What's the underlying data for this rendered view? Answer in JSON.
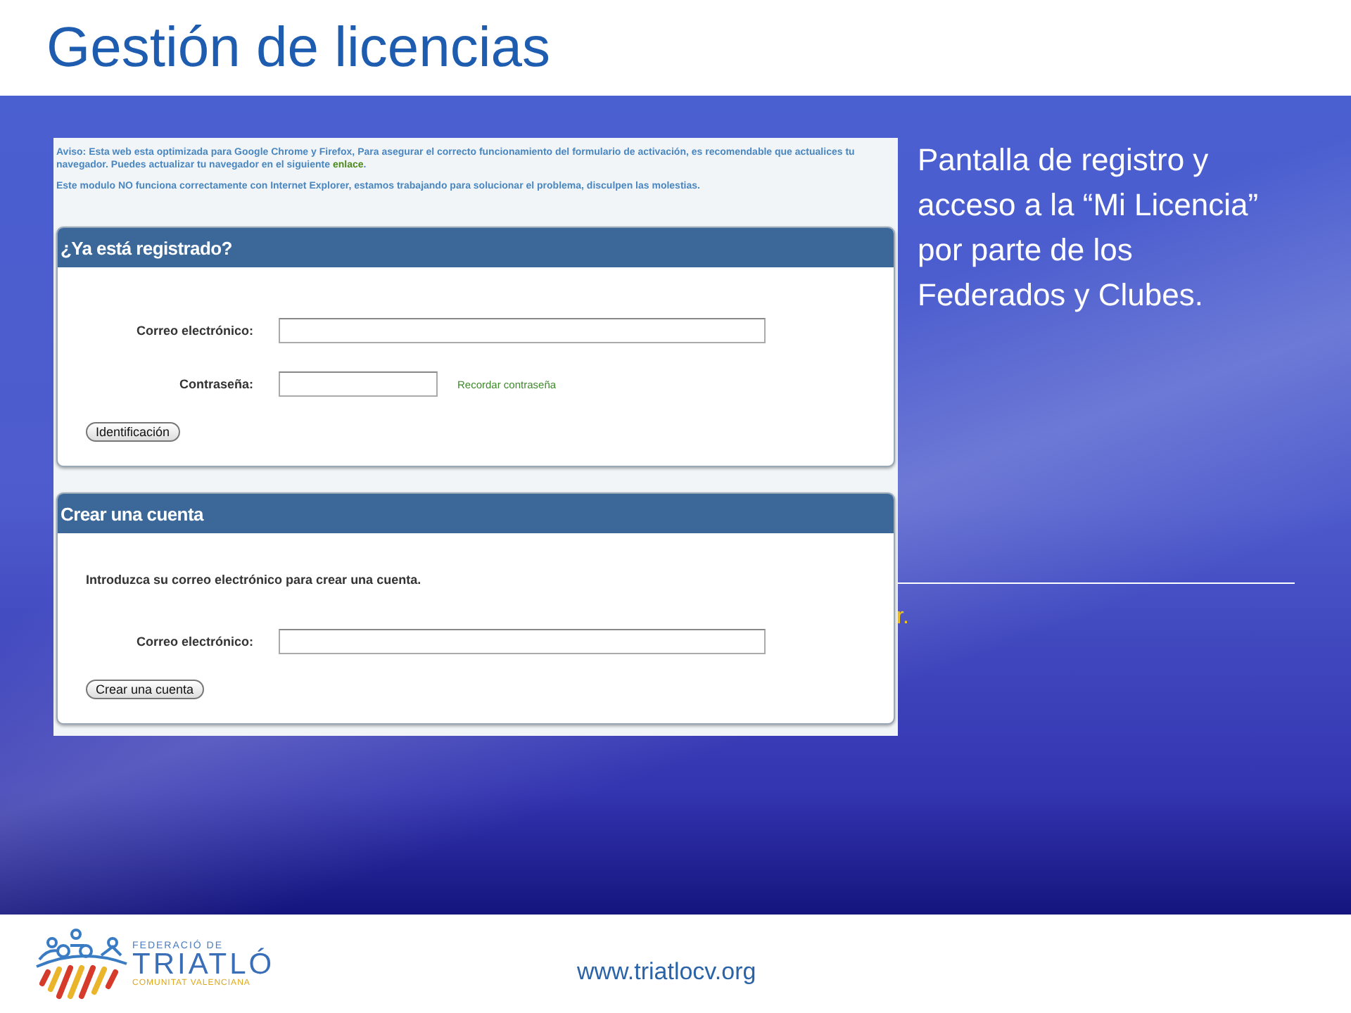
{
  "slide": {
    "title": "Gestión de licencias",
    "description": "Pantalla de registro y acceso a la “Mi Licencia” por parte de los Federados y Clubes.",
    "covered_text": "r."
  },
  "screenshot": {
    "notice": {
      "text": "Aviso: Esta web esta optimizada para Google Chrome y Firefox, Para asegurar el correcto funcionamiento del formulario de activación, es recomendable que actualices tu navegador. Puedes actualizar tu navegador en el siguiente ",
      "link": "enlace",
      "end": "."
    },
    "warning": "Este modulo NO funciona correctamente con Internet Explorer, estamos trabajando para solucionar el problema, disculpen las molestias.",
    "panels": [
      {
        "title": "¿Ya está registrado?",
        "fields": [
          {
            "kind": "wide",
            "label": "Correo electrónico:"
          },
          {
            "kind": "short",
            "label": "Contraseña:",
            "link": "Recordar contraseña"
          }
        ],
        "button": "Identificación"
      },
      {
        "title": "Crear una cuenta",
        "intro": "Introduzca su correo electrónico para crear una cuenta.",
        "fields": [
          {
            "kind": "wide",
            "label": "Correo electrónico:"
          }
        ],
        "button": "Crear una cuenta"
      }
    ]
  },
  "footer": {
    "logo": {
      "line_1": "FEDERACIÓ DE",
      "line_2": "TRIATLÓ",
      "line_3": "COMUNITAT VALENCIANA"
    },
    "url": "www.triatlocv.org"
  }
}
